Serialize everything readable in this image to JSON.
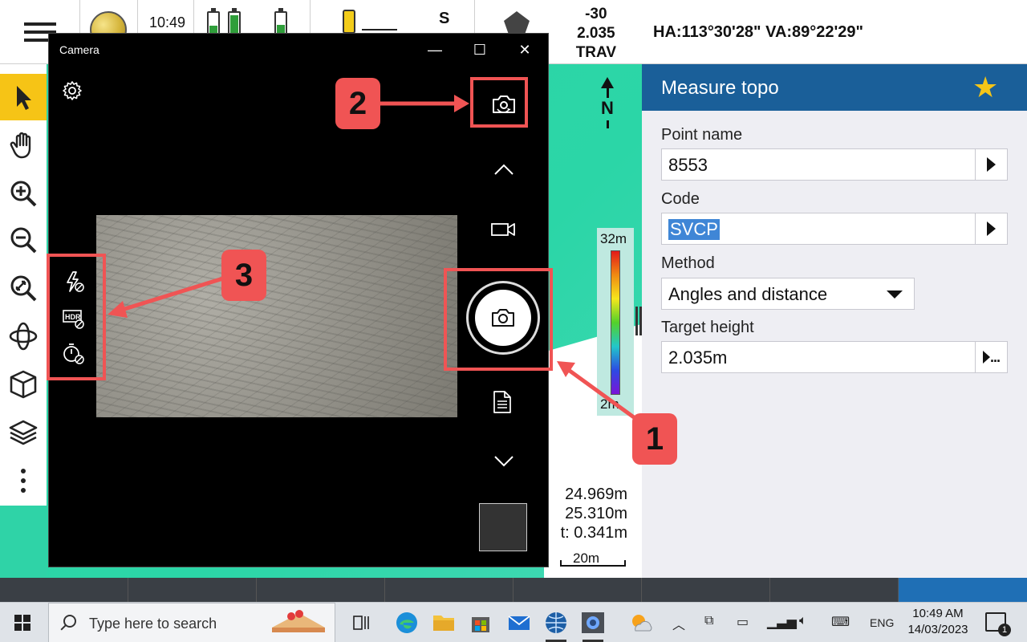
{
  "status_bar": {
    "time": "10:49",
    "sensor_label": "S",
    "instrument": {
      "line1": "-30",
      "line2": "2.035",
      "line3": "TRAV"
    },
    "battery_levels": [
      0.35,
      0.85,
      0.4
    ]
  },
  "angles": {
    "text": "HA:113°30'28\"  VA:89°22'29\""
  },
  "left_tools": [
    "select-arrow-icon",
    "pan-hand-icon",
    "zoom-in-icon",
    "zoom-out-icon",
    "zoom-extents-icon",
    "orbit-icon",
    "cube-view-icon",
    "layers-icon",
    "more-icon"
  ],
  "map": {
    "north_label": "N",
    "colorbar": {
      "top": "32m",
      "bottom": "2m"
    },
    "measure_lines": [
      "24.969m",
      "25.310m",
      "t: 0.341m"
    ],
    "scale_label": "20m"
  },
  "panel": {
    "title": "Measure topo",
    "point_name": {
      "label": "Point name",
      "value": "8553"
    },
    "code": {
      "label": "Code",
      "value": "SVCP"
    },
    "method": {
      "label": "Method",
      "value": "Angles and distance"
    },
    "target_height": {
      "label": "Target height",
      "value": "2.035m"
    },
    "colors": {
      "header": "#1a5f99",
      "star": "#f5c518",
      "highlight": "#3f86d6"
    }
  },
  "camera": {
    "title": "Camera",
    "minimize": "—",
    "maximize": "☐",
    "close": "✕"
  },
  "annotations": {
    "badge1": "1",
    "badge2": "2",
    "badge3": "3",
    "color": "#f05454"
  },
  "taskbar": {
    "search_placeholder": "Type here to search",
    "time": "10:49 AM",
    "date": "14/03/2023",
    "language": "ENG",
    "notifications": "1"
  }
}
